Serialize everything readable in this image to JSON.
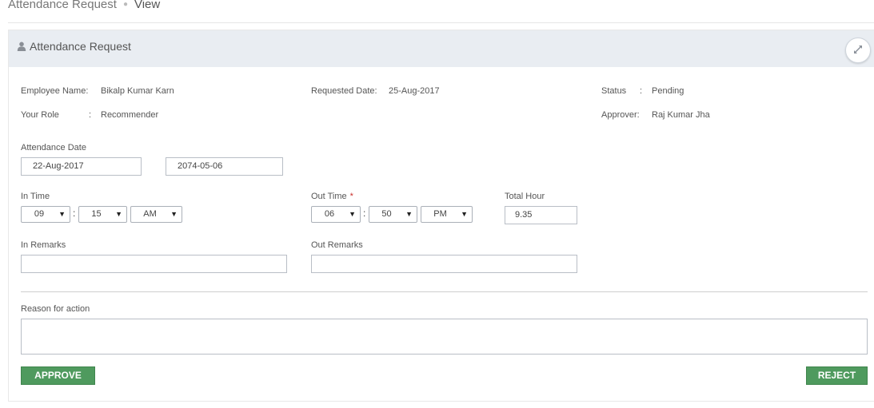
{
  "breadcrumb": {
    "parent": "Attendance Request",
    "current": "View"
  },
  "panel": {
    "title": "Attendance Request"
  },
  "info": {
    "employee_name_label": "Employee Name:",
    "employee_name": "Bikalp Kumar Karn",
    "requested_date_label": "Requested Date:",
    "requested_date": "25-Aug-2017",
    "status_label": "Status",
    "status_colon": ":",
    "status": "Pending",
    "role_label": "Your Role",
    "role_colon": ":",
    "role": "Recommender",
    "approver_label": "Approver:",
    "approver": "Raj Kumar Jha"
  },
  "attendance_date": {
    "label": "Attendance Date",
    "ad": "22-Aug-2017",
    "bs": "2074-05-06"
  },
  "in_time": {
    "label": "In Time",
    "hour": "09",
    "minute": "15",
    "meridiem": "AM"
  },
  "out_time": {
    "label": "Out Time",
    "required_mark": "*",
    "hour": "06",
    "minute": "50",
    "meridiem": "PM"
  },
  "time_separator": ":",
  "total_hour": {
    "label": "Total Hour",
    "value": "9.35"
  },
  "in_remarks": {
    "label": "In Remarks",
    "value": ""
  },
  "out_remarks": {
    "label": "Out Remarks",
    "value": ""
  },
  "reason": {
    "label": "Reason for action",
    "value": ""
  },
  "buttons": {
    "approve": "APPROVE",
    "reject": "REJECT"
  },
  "colors": {
    "button_green": "#4f9a5e",
    "header_bg": "#e9edf2",
    "required_red": "#c9302c"
  },
  "icons": {
    "panel": "user-icon",
    "expand": "expand-icon",
    "dropdown": "caret-down-icon"
  }
}
